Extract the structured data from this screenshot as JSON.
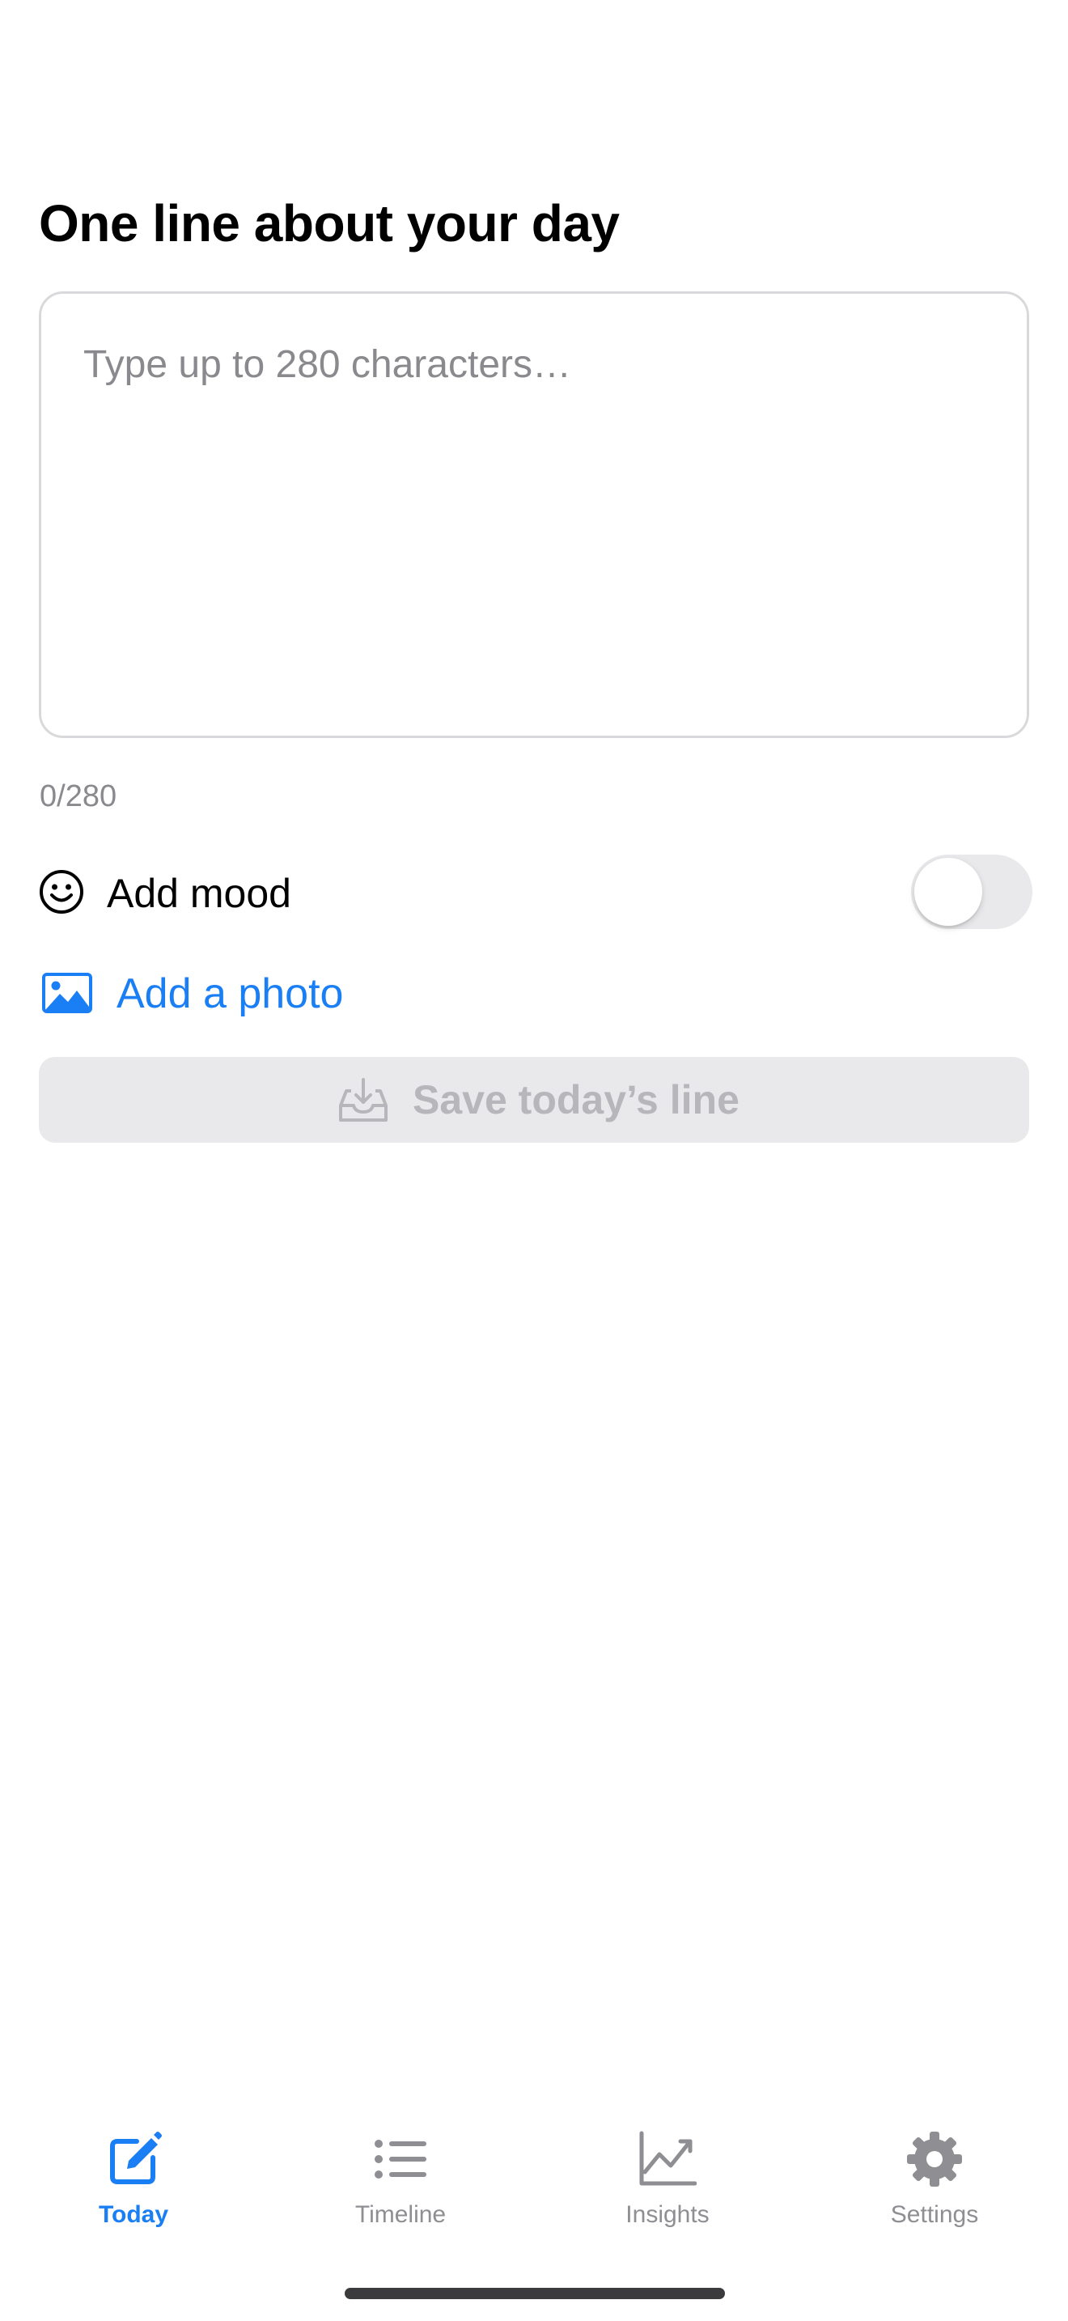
{
  "composer": {
    "title": "One line about your day",
    "text_value": "",
    "placeholder": "Type up to 280 characters…",
    "counter": "0/280"
  },
  "mood": {
    "label": "Add mood",
    "icon": "smiley-face-icon",
    "toggle_on": false
  },
  "photo": {
    "label": "Add a photo",
    "icon": "photo-icon"
  },
  "save": {
    "label": "Save today’s line",
    "icon": "tray-download-icon",
    "enabled": false
  },
  "tabs": [
    {
      "label": "Today",
      "icon": "compose-icon",
      "active": true
    },
    {
      "label": "Timeline",
      "icon": "list-icon",
      "active": false
    },
    {
      "label": "Insights",
      "icon": "chart-line-icon",
      "active": false
    },
    {
      "label": "Settings",
      "icon": "gear-icon",
      "active": false
    }
  ],
  "colors": {
    "accent": "#1a7ff5",
    "inactive_tab": "#8e8e93",
    "placeholder": "#8a8a8e",
    "disabled_fill": "#e9e9eb",
    "disabled_text": "#b7b7bb",
    "border": "#d9d9dc"
  }
}
